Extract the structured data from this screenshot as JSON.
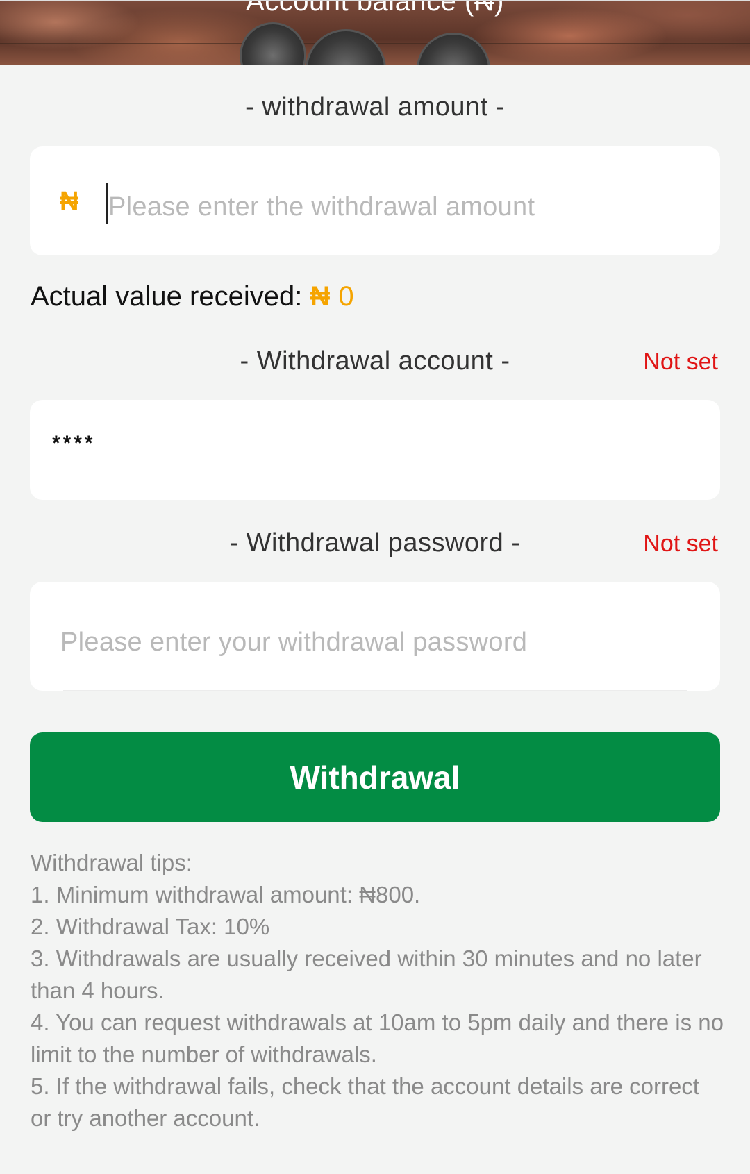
{
  "banner": {
    "title": "Account balance (₦)"
  },
  "amount_section": {
    "title": "- withdrawal amount -",
    "currency_symbol": "₦",
    "placeholder": "Please enter the withdrawal amount"
  },
  "actual": {
    "label": "Actual value received: ",
    "currency_symbol": "₦",
    "value": "0"
  },
  "account_section": {
    "title": "- Withdrawal account -",
    "status": "Not set",
    "value": "****"
  },
  "password_section": {
    "title": "- Withdrawal password -",
    "status": "Not set",
    "placeholder": "Please enter your withdrawal password"
  },
  "submit": {
    "label": "Withdrawal"
  },
  "tips": {
    "heading": "Withdrawal tips:",
    "items": [
      "1. Minimum withdrawal amount: ₦800.",
      "2. Withdrawal Tax: 10%",
      "3. Withdrawals are usually received within 30 minutes and no later than 4 hours.",
      "4. You can request withdrawals at 10am to 5pm daily and there is no limit to the number of withdrawals.",
      "5. If the withdrawal fails, check that the account details are correct or try another account."
    ]
  },
  "colors": {
    "accent_currency": "#f5a400",
    "status_red": "#e01515",
    "button_green": "#038c44",
    "background": "#f3f4f3"
  }
}
